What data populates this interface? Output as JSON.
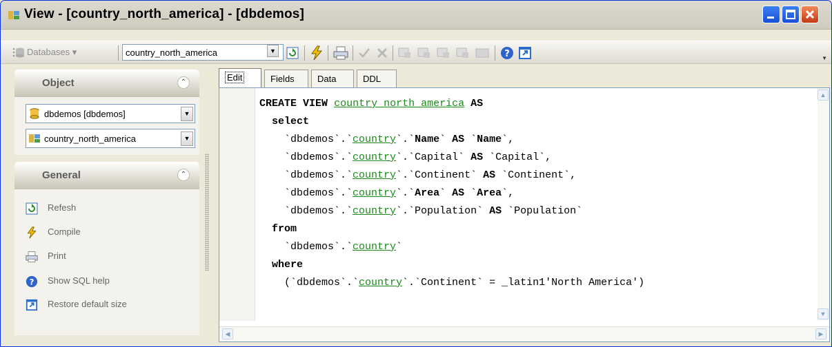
{
  "window": {
    "title": "View - [country_north_america] - [dbdemos]"
  },
  "toolbar": {
    "databases_label": "Databases ▾",
    "object_value": "country_north_america"
  },
  "sidebar": {
    "object_header": "Object",
    "database_value": "dbdemos [dbdemos]",
    "view_value": "country_north_america",
    "general_header": "General",
    "items": [
      {
        "label": "Refesh",
        "icon": "refresh-icon"
      },
      {
        "label": "Compile",
        "icon": "compile-icon"
      },
      {
        "label": "Print",
        "icon": "print-icon"
      },
      {
        "label": "Show SQL help",
        "icon": "help-icon"
      },
      {
        "label": "Restore default size",
        "icon": "restore-size-icon"
      }
    ]
  },
  "tabs": [
    {
      "label": "Edit",
      "active": true
    },
    {
      "label": "Fields",
      "active": false
    },
    {
      "label": "Data",
      "active": false
    },
    {
      "label": "DDL",
      "active": false
    }
  ],
  "editor": {
    "lines": [
      "CREATE VIEW country_north_america AS",
      "  select",
      "    `dbdemos`.`country`.`Name` AS `Name`,",
      "    `dbdemos`.`country`.`Capital` AS `Capital`,",
      "    `dbdemos`.`country`.`Continent` AS `Continent`,",
      "    `dbdemos`.`country`.`Area` AS `Area`,",
      "    `dbdemos`.`country`.`Population` AS `Population`",
      "  from",
      "    `dbdemos`.`country`",
      "  where",
      "    (`dbdemos`.`country`.`Continent` = _latin1'North America')"
    ]
  },
  "colors": {
    "title_bar": "#0831d9",
    "link_green": "#1a8a1a",
    "panel_bg": "#f3f2ec"
  }
}
